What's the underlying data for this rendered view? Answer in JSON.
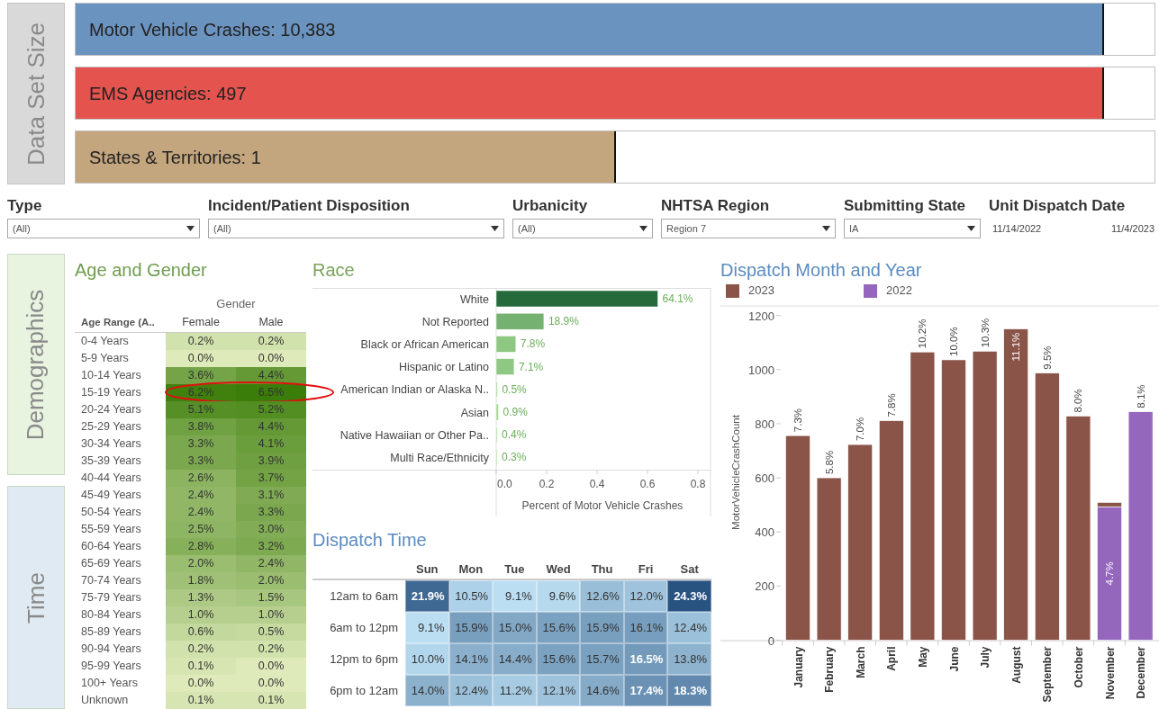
{
  "data_set_size": {
    "tab": "Data Set Size",
    "bars": [
      {
        "label": "Motor Vehicle Crashes: 10,383",
        "level": 0.953,
        "color": "#6b93bf"
      },
      {
        "label": "EMS Agencies: 497",
        "level": 0.953,
        "color": "#e5534f"
      },
      {
        "label": "States & Territories: 1",
        "level": 0.501,
        "color": "#c3a57e"
      }
    ]
  },
  "filters": [
    {
      "kind": "dropdown",
      "label": "Type",
      "value": "(All)"
    },
    {
      "kind": "dropdown",
      "label": "Incident/Patient Disposition",
      "value": "(All)"
    },
    {
      "kind": "dropdown",
      "label": "Urbanicity",
      "value": "(All)"
    },
    {
      "kind": "dropdown",
      "label": "NHTSA Region",
      "value": "Region 7"
    },
    {
      "kind": "dropdown",
      "label": "Submitting State",
      "value": "IA"
    },
    {
      "kind": "date_range",
      "label": "Unit Dispatch Date",
      "start": "11/14/2022",
      "end": "11/4/2023"
    }
  ],
  "side_tabs": [
    {
      "label": "Demographics",
      "color": "#e8f3e0"
    },
    {
      "label": "Time",
      "color": "#dfeaf2"
    }
  ],
  "age_gender": {
    "title": "Age and Gender",
    "super_header": "Gender",
    "columns": [
      "Age Range (A..",
      "Female",
      "Male"
    ],
    "rows": [
      {
        "age": "0-4 Years",
        "female": "0.2%",
        "male": "0.2%",
        "circled": false
      },
      {
        "age": "5-9 Years",
        "female": "0.0%",
        "male": "0.0%",
        "circled": false
      },
      {
        "age": "10-14 Years",
        "female": "3.6%",
        "male": "4.4%",
        "circled": false
      },
      {
        "age": "15-19 Years",
        "female": "6.2%",
        "male": "6.5%",
        "circled": true
      },
      {
        "age": "20-24 Years",
        "female": "5.1%",
        "male": "5.2%",
        "circled": false
      },
      {
        "age": "25-29 Years",
        "female": "3.8%",
        "male": "4.4%",
        "circled": false
      },
      {
        "age": "30-34 Years",
        "female": "3.3%",
        "male": "4.1%",
        "circled": false
      },
      {
        "age": "35-39 Years",
        "female": "3.3%",
        "male": "3.9%",
        "circled": false
      },
      {
        "age": "40-44 Years",
        "female": "2.6%",
        "male": "3.7%",
        "circled": false
      },
      {
        "age": "45-49 Years",
        "female": "2.4%",
        "male": "3.1%",
        "circled": false
      },
      {
        "age": "50-54 Years",
        "female": "2.4%",
        "male": "3.3%",
        "circled": false
      },
      {
        "age": "55-59 Years",
        "female": "2.5%",
        "male": "3.0%",
        "circled": false
      },
      {
        "age": "60-64 Years",
        "female": "2.8%",
        "male": "3.2%",
        "circled": false
      },
      {
        "age": "65-69 Years",
        "female": "2.0%",
        "male": "2.4%",
        "circled": false
      },
      {
        "age": "70-74 Years",
        "female": "1.8%",
        "male": "2.0%",
        "circled": false
      },
      {
        "age": "75-79 Years",
        "female": "1.3%",
        "male": "1.5%",
        "circled": false
      },
      {
        "age": "80-84 Years",
        "female": "1.0%",
        "male": "1.0%",
        "circled": false
      },
      {
        "age": "85-89 Years",
        "female": "0.6%",
        "male": "0.5%",
        "circled": false
      },
      {
        "age": "90-94 Years",
        "female": "0.2%",
        "male": "0.2%",
        "circled": false
      },
      {
        "age": "95-99 Years",
        "female": "0.1%",
        "male": "0.0%",
        "circled": false
      },
      {
        "age": "100+ Years",
        "female": "0.0%",
        "male": "0.0%",
        "circled": false
      },
      {
        "age": "Unknown",
        "female": "0.1%",
        "male": "0.1%",
        "circled": false
      }
    ]
  },
  "race": {
    "title": "Race",
    "chart_data": {
      "type": "bar",
      "orientation": "horizontal",
      "xlabel": "Percent of Motor Vehicle Crashes",
      "categories": [
        "White",
        "Not Reported",
        "Black or African American",
        "Hispanic or Latino",
        "American Indian or Alaska N..",
        "Asian",
        "Native Hawaiian or Other Pa..",
        "Multi Race/Ethnicity"
      ],
      "values": [
        0.641,
        0.189,
        0.078,
        0.071,
        0.005,
        0.009,
        0.004,
        0.003
      ],
      "value_labels": [
        "64.1%",
        "18.9%",
        "7.8%",
        "7.1%",
        "0.5%",
        "0.9%",
        "0.4%",
        "0.3%"
      ],
      "xlim": [
        0,
        0.85
      ],
      "xticks": [
        {
          "value": 0,
          "label": "0.0"
        },
        {
          "value": 0.2,
          "label": "0.2"
        },
        {
          "value": 0.4,
          "label": "0.4"
        },
        {
          "value": 0.6,
          "label": "0.6"
        },
        {
          "value": 0.8,
          "label": "0.8"
        }
      ]
    }
  },
  "dispatch_time": {
    "title": "Dispatch Time",
    "columns": [
      "Sun",
      "Mon",
      "Tue",
      "Wed",
      "Thu",
      "Fri",
      "Sat"
    ],
    "rows": [
      {
        "label": "12am to 6am",
        "values": [
          "21.9%",
          "10.5%",
          "9.1%",
          "9.6%",
          "12.6%",
          "12.0%",
          "24.3%"
        ]
      },
      {
        "label": "6am to 12pm",
        "values": [
          "9.1%",
          "15.9%",
          "15.0%",
          "15.6%",
          "15.9%",
          "16.1%",
          "12.4%"
        ]
      },
      {
        "label": "12pm to 6pm",
        "values": [
          "10.0%",
          "14.1%",
          "14.4%",
          "15.6%",
          "15.7%",
          "16.5%",
          "13.8%"
        ]
      },
      {
        "label": "6pm to 12am",
        "values": [
          "14.0%",
          "12.4%",
          "11.2%",
          "12.1%",
          "14.6%",
          "17.4%",
          "18.3%"
        ]
      }
    ]
  },
  "dispatch_month": {
    "title": "Dispatch Month and Year",
    "chart_data": {
      "type": "bar",
      "stacked": true,
      "ylabel": "MotorVehicleCrashCount",
      "categories": [
        "January",
        "February",
        "March",
        "April",
        "May",
        "June",
        "July",
        "August",
        "September",
        "October",
        "November",
        "December"
      ],
      "ylim": [
        0,
        1227
      ],
      "yticks": [
        0,
        200,
        400,
        600,
        800,
        1000,
        1200
      ],
      "series": [
        {
          "name": "2023",
          "color": "#8b5448",
          "values": [
            756,
            600,
            723,
            811,
            1065,
            1036,
            1068,
            1150,
            987,
            828,
            16,
            null
          ]
        },
        {
          "name": "2022",
          "color": "#9467bd",
          "values": [
            null,
            null,
            null,
            null,
            null,
            null,
            null,
            null,
            null,
            null,
            493,
            844
          ]
        }
      ],
      "annotations": [
        {
          "x": "January",
          "y": 756,
          "text": "7.3%"
        },
        {
          "x": "February",
          "y": 600,
          "text": "5.8%"
        },
        {
          "x": "March",
          "y": 723,
          "text": "7.0%"
        },
        {
          "x": "April",
          "y": 811,
          "text": "7.8%"
        },
        {
          "x": "May",
          "y": 1065,
          "text": "10.2%"
        },
        {
          "x": "June",
          "y": 1036,
          "text": "10.0%"
        },
        {
          "x": "July",
          "y": 1068,
          "text": "10.3%"
        },
        {
          "x": "August",
          "y": 1150,
          "text": "11.1%"
        },
        {
          "x": "September",
          "y": 987,
          "text": "9.5%"
        },
        {
          "x": "October",
          "y": 828,
          "text": "8.0%"
        },
        "4.7%",
        {
          "x": "December",
          "y": 844,
          "text": "8.1%"
        }
      ]
    }
  }
}
